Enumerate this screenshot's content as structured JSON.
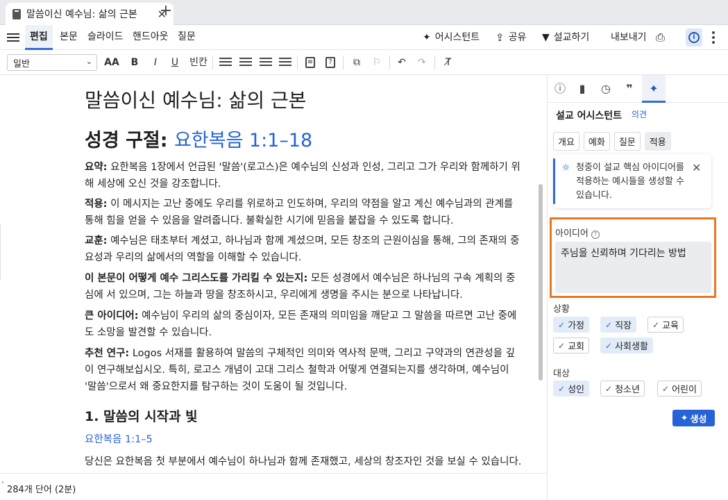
{
  "tab": {
    "title": "말씀이신 예수님: 삶의 근본",
    "close": "✕",
    "new": "+"
  },
  "menu": {
    "items": [
      "편집",
      "본문",
      "슬라이드",
      "핸드아웃",
      "질문"
    ],
    "assistant": "어시스턴트",
    "share": "공유",
    "preach": "설교하기",
    "export": "내보내기"
  },
  "toolbar": {
    "style": "일반",
    "underline_label": "빈칸"
  },
  "document": {
    "title": "말씀이신 예수님: 삶의 근본",
    "heading_prefix": "성경 구절:",
    "heading_ref": "요한복음 1:1–18",
    "paragraphs": [
      {
        "label": "요약:",
        "text": "요한복음 1장에서 언급된 '말씀'(로고스)은 예수님의 신성과 인성, 그리고 그가 우리와 함께하기 위해 세상에 오신 것을 강조합니다."
      },
      {
        "label": "적용:",
        "text": "이 메시지는 고난 중에도 우리를 위로하고 인도하며, 우리의 약점을 알고 계신 예수님과의 관계를 통해 힘을 얻을 수 있음을 알려줍니다. 불확실한 시기에 믿음을 붙잡을 수 있도록 합니다."
      },
      {
        "label": "교훈:",
        "text": "예수님은 태초부터 계셨고, 하나님과 함께 계셨으며, 모든 창조의 근원이심을 통해, 그의 존재의 중요성과 우리의 삶에서의 역할을 이해할 수 있습니다."
      },
      {
        "label": "이 본문이 어떻게 예수 그리스도를 가리킬 수 있는지:",
        "text": "모든 성경에서 예수님은 하나님의 구속 계획의 중심에 서 있으며, 그는 하늘과 땅을 창조하시고, 우리에게 생명을 주시는 분으로 나타납니다."
      },
      {
        "label": "큰 아이디어:",
        "text": "예수님이 우리의 삶의 중심이자, 모든 존재의 의미임을 깨닫고 그 말씀을 따르면 고난 중에도 소망을 발견할 수 있습니다."
      },
      {
        "label": "추천 연구:",
        "text": "Logos 서재를 활용하여 말씀의 구체적인 의미와 역사적 문맥, 그리고 구약과의 연관성을 깊이 연구해보십시오. 특히, 로고스 개념이 고대 그리스 철학과 어떻게 연결되는지를 생각하며, 예수님이 '말씀'으로서 왜 중요한지를 탐구하는 것이 도움이 될 것입니다."
      }
    ],
    "section_heading": "1. 말씀의 시작과 빛",
    "section_ref": "요한복음 1:1–5",
    "section_text": "당신은 요한복음 첫 부분에서 예수님이 하나님과 함께 존재했고, 세상의 창조자인 것을 보실 수 있습니다."
  },
  "status": {
    "word_count": "284개 단어 (2분)"
  },
  "panel": {
    "title": "설교 어시스턴트",
    "feedback": "의견",
    "tabs": [
      "개요",
      "예화",
      "질문",
      "적용"
    ],
    "tip": "청중이 설교 핵심 아이디어를 적용하는 예시들을 생성할 수 있습니다.",
    "idea_label": "아이디어",
    "idea_value": "주님을 신뢰하며 기다리는 방법",
    "situation_label": "상황",
    "situations": [
      {
        "label": "가정",
        "on": true
      },
      {
        "label": "직장",
        "on": true
      },
      {
        "label": "교육",
        "on": false
      },
      {
        "label": "교회",
        "on": false
      },
      {
        "label": "사회생활",
        "on": true
      }
    ],
    "audience_label": "대상",
    "audiences": [
      {
        "label": "성인",
        "on": true
      },
      {
        "label": "청소년",
        "on": false
      },
      {
        "label": "어린이",
        "on": false
      }
    ],
    "generate": "생성"
  },
  "colors": {
    "accent": "#2563d6",
    "highlight": "#e87722",
    "tag_on": "#e2ecf8"
  }
}
